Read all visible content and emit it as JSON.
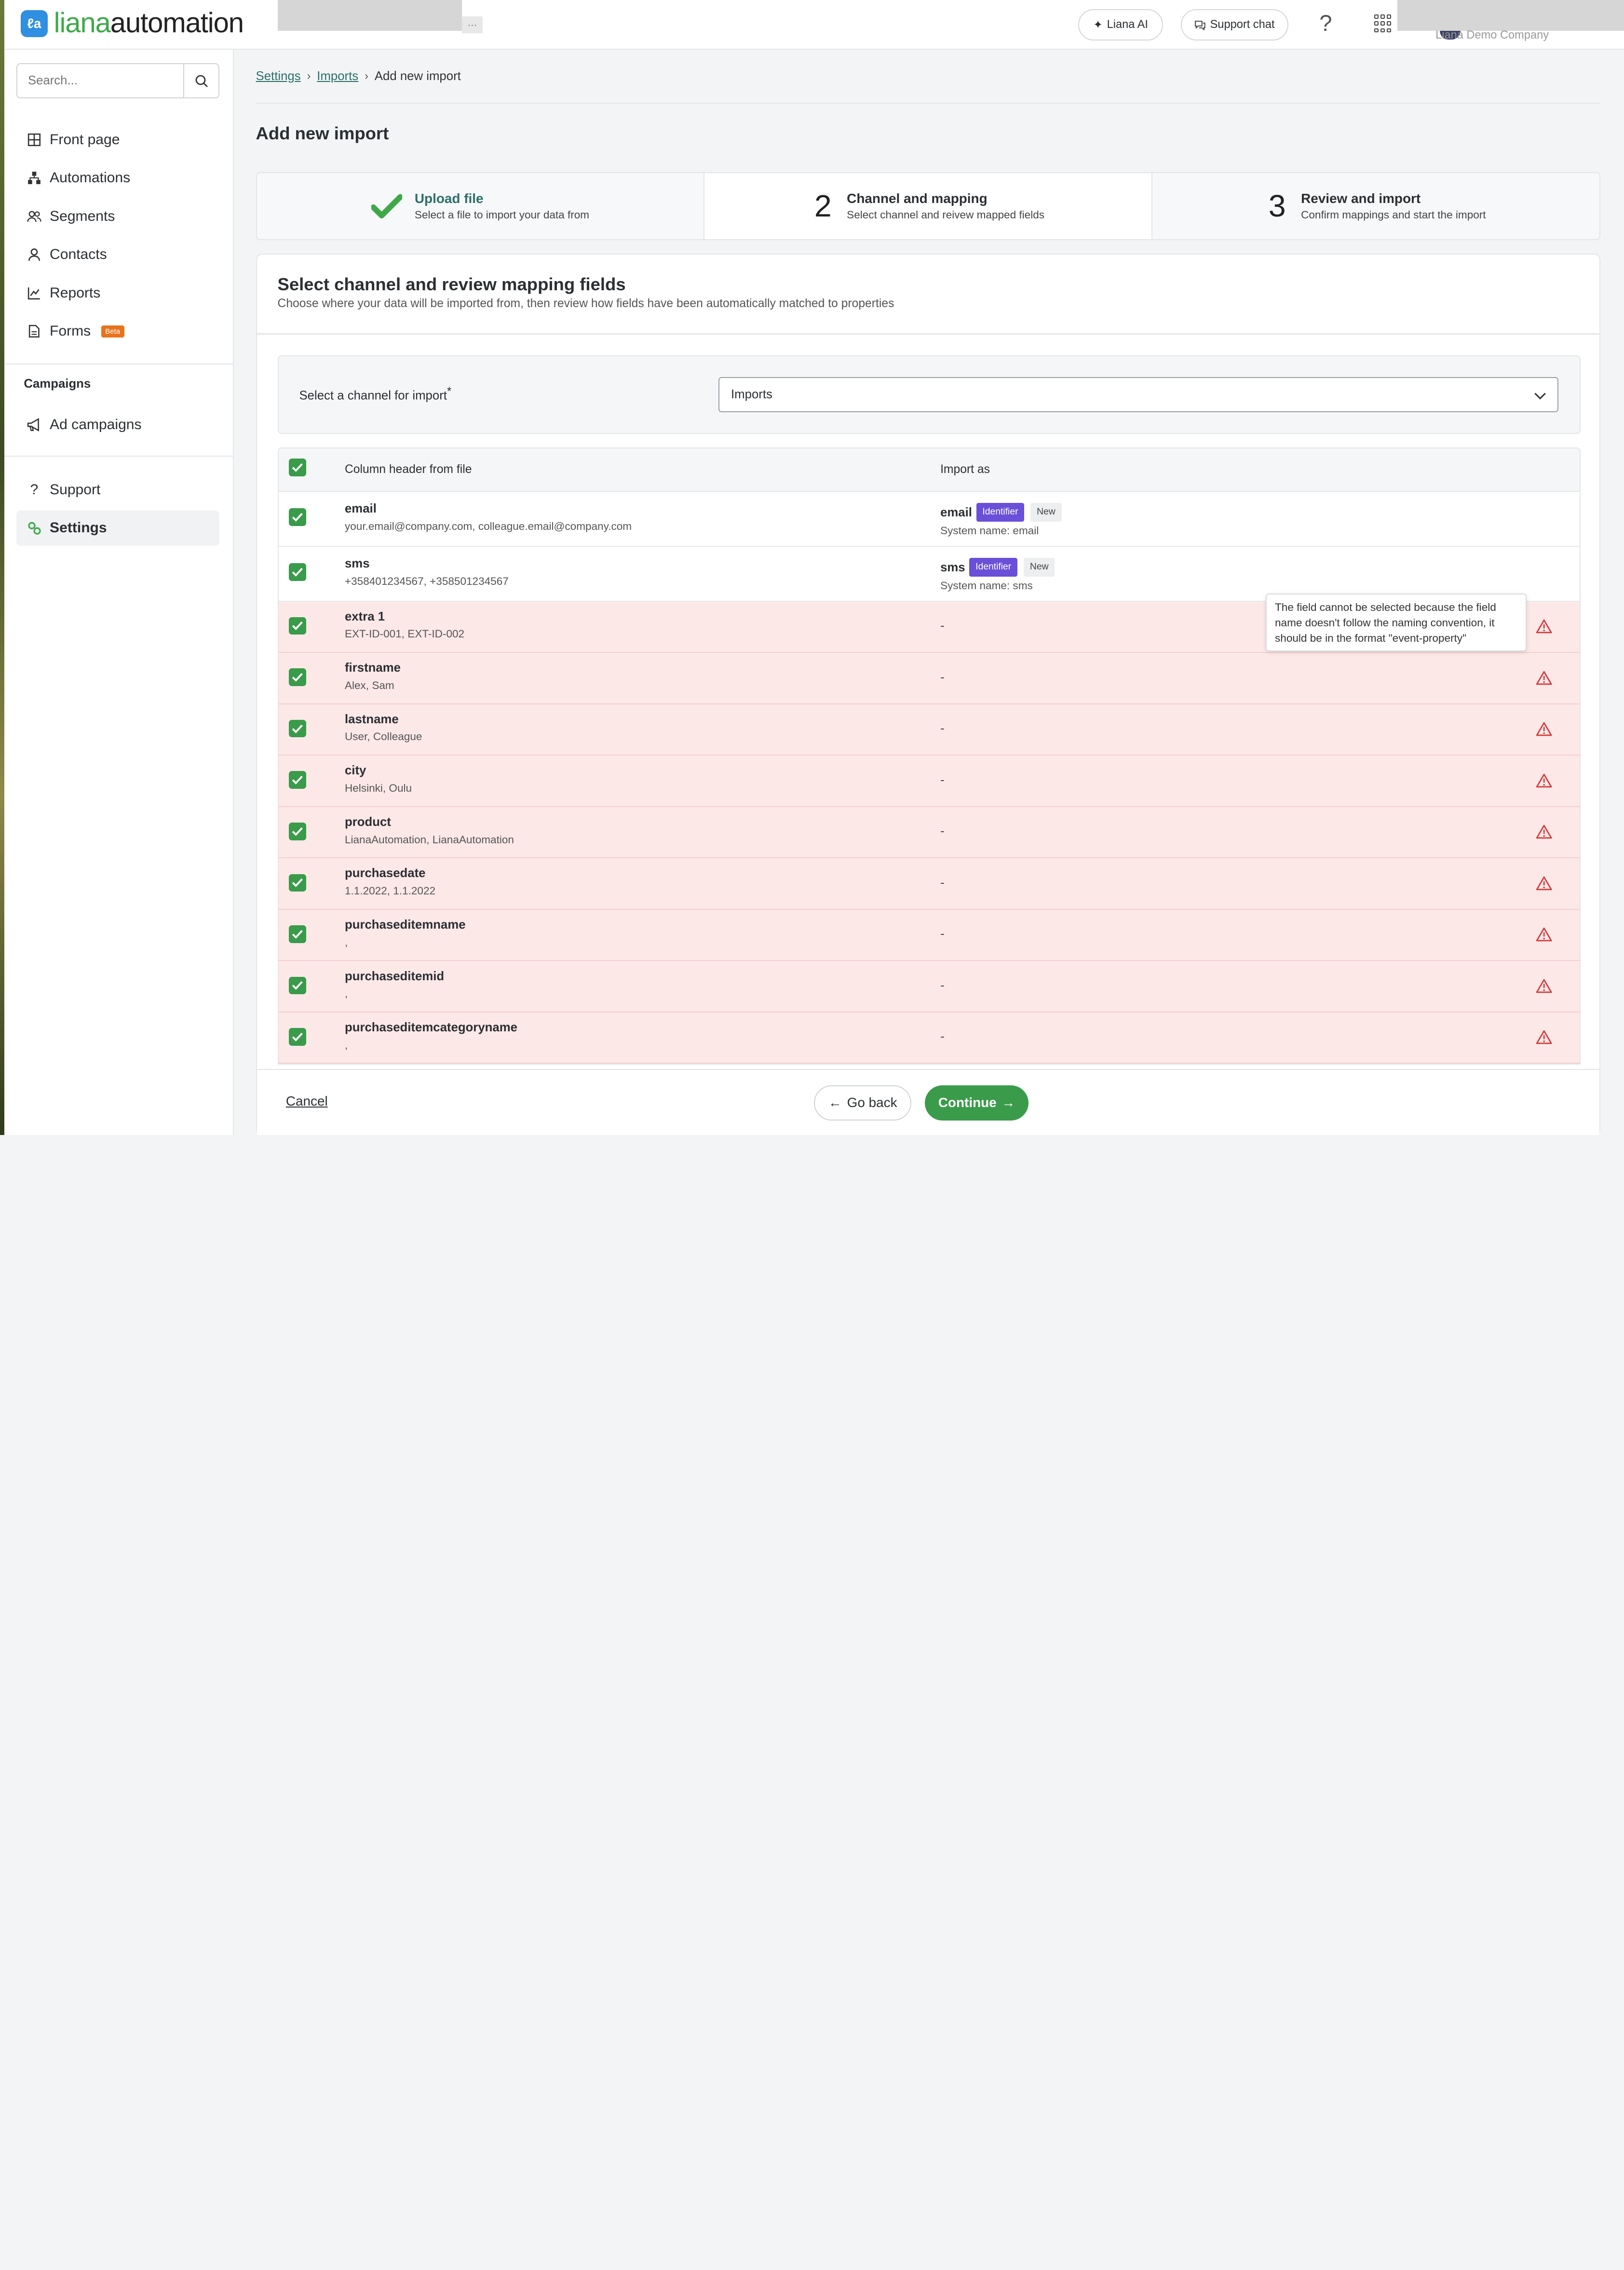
{
  "topbar": {
    "logo_primary": "liana",
    "logo_secondary": "automation",
    "logo_mark": "ℓa",
    "redacted_suffix": "...",
    "liana_ai_label": "Liana AI",
    "support_chat_label": "Support chat",
    "help_icon": "?",
    "company_name": "Liana Demo Company"
  },
  "sidebar": {
    "search_placeholder": "Search...",
    "items": [
      {
        "label": "Front page",
        "icon": "grid-icon"
      },
      {
        "label": "Automations",
        "icon": "sitemap-icon"
      },
      {
        "label": "Segments",
        "icon": "users-icon"
      },
      {
        "label": "Contacts",
        "icon": "user-icon"
      },
      {
        "label": "Reports",
        "icon": "chart-icon"
      },
      {
        "label": "Forms",
        "icon": "document-icon",
        "badge": "Beta"
      }
    ],
    "campaigns_heading": "Campaigns",
    "campaign_items": [
      {
        "label": "Ad campaigns",
        "icon": "megaphone-icon"
      }
    ],
    "bottom_items": [
      {
        "label": "Support",
        "icon": "question-icon"
      },
      {
        "label": "Settings",
        "icon": "gears-icon",
        "active": true
      }
    ]
  },
  "breadcrumb": {
    "items": [
      "Settings",
      "Imports"
    ],
    "current": "Add new import"
  },
  "page_title": "Add new import",
  "steps": [
    {
      "marker": "✔",
      "title": "Upload file",
      "subtitle": "Select a file to import your data from",
      "status": "done"
    },
    {
      "marker": "2",
      "title": "Channel and mapping",
      "subtitle": "Select channel and reivew mapped fields",
      "status": "current"
    },
    {
      "marker": "3",
      "title": "Review and import",
      "subtitle": "Confirm mappings and start the import",
      "status": "upcoming"
    }
  ],
  "card": {
    "title": "Select channel and review mapping fields",
    "subtitle": "Choose where your data will be imported from, then review how fields have been automatically matched to properties"
  },
  "channel": {
    "label": "Select a channel for import",
    "required_mark": "*",
    "value": "Imports"
  },
  "table": {
    "header_col1": "Column header from file",
    "header_col2": "Import as",
    "rows": [
      {
        "name": "email",
        "sample": "your.email@company.com, colleague.email@company.com",
        "import_as": "email",
        "tag_identifier": "Identifier",
        "tag_new": "New",
        "system_name": "System name: email",
        "error": false
      },
      {
        "name": "sms",
        "sample": "+358401234567, +358501234567",
        "import_as": "sms",
        "tag_identifier": "Identifier",
        "tag_new": "New",
        "system_name": "System name: sms",
        "error": false
      },
      {
        "name": "extra 1",
        "sample": "EXT-ID-001, EXT-ID-002",
        "import_as": "-",
        "error": true
      },
      {
        "name": "firstname",
        "sample": "Alex, Sam",
        "import_as": "-",
        "error": true
      },
      {
        "name": "lastname",
        "sample": "User, Colleague",
        "import_as": "-",
        "error": true
      },
      {
        "name": "city",
        "sample": "Helsinki, Oulu",
        "import_as": "-",
        "error": true
      },
      {
        "name": "product",
        "sample": "LianaAutomation, LianaAutomation",
        "import_as": "-",
        "error": true
      },
      {
        "name": "purchasedate",
        "sample": "1.1.2022, 1.1.2022",
        "import_as": "-",
        "error": true
      },
      {
        "name": "purchaseditemname",
        "sample": ",",
        "import_as": "-",
        "error": true
      },
      {
        "name": "purchaseditemid",
        "sample": ",",
        "import_as": "-",
        "error": true
      },
      {
        "name": "purchaseditemcategoryname",
        "sample": ",",
        "import_as": "-",
        "error": true
      }
    ]
  },
  "tooltip": "The field cannot be selected because the field name doesn't follow the naming convention, it should be in the format \"event-property\"",
  "footer": {
    "cancel": "Cancel",
    "go_back": "Go back",
    "continue": "Continue"
  },
  "colors": {
    "brand_green": "#3a9b4a",
    "identifier_purple": "#6a4fd8",
    "error_row": "#fde8e8",
    "warning_red": "#d33a3a",
    "beta_orange": "#e8731d"
  }
}
